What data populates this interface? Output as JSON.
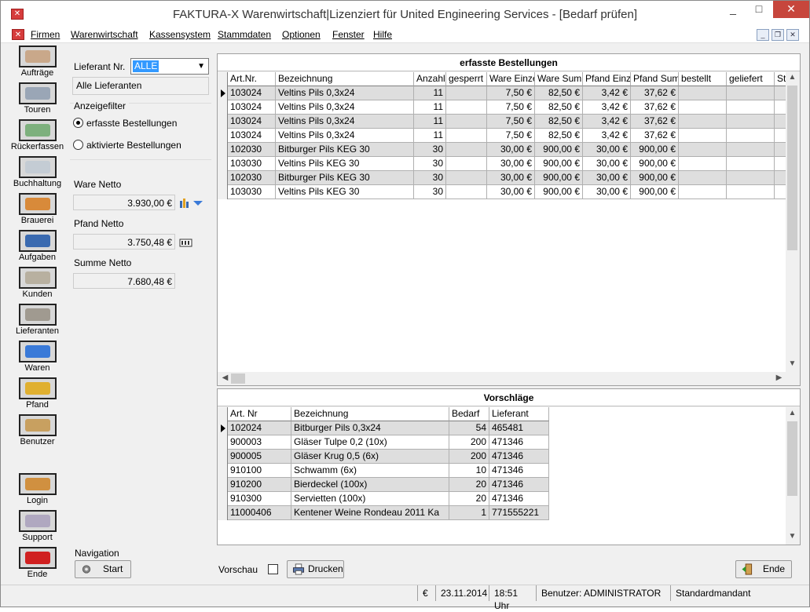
{
  "window": {
    "title": "FAKTURA-X Warenwirtschaft|Lizenziert für United Engineering Services - [Bedarf prüfen]"
  },
  "menu": [
    "Firmen",
    "Warenwirtschaft",
    "Kassensystem",
    "Stammdaten",
    "Optionen",
    "Fenster",
    "Hilfe"
  ],
  "sidebar": [
    {
      "label": "Aufträge",
      "icon": "orders-icon"
    },
    {
      "label": "Touren",
      "icon": "truck-icon"
    },
    {
      "label": "Rückerfassen",
      "icon": "return-icon"
    },
    {
      "label": "Buchhaltung",
      "icon": "accounting-icon"
    },
    {
      "label": "Brauerei",
      "icon": "brewery-icon"
    },
    {
      "label": "Aufgaben",
      "icon": "tasks-icon"
    },
    {
      "label": "Kunden",
      "icon": "customers-icon"
    },
    {
      "label": "Lieferanten",
      "icon": "suppliers-icon"
    },
    {
      "label": "Waren",
      "icon": "goods-icon"
    },
    {
      "label": "Pfand",
      "icon": "deposit-icon"
    },
    {
      "label": "Benutzer",
      "icon": "user-icon"
    },
    {
      "label": "Login",
      "icon": "key-icon"
    },
    {
      "label": "Support",
      "icon": "handshake-icon"
    },
    {
      "label": "Ende",
      "icon": "power-icon"
    }
  ],
  "filter": {
    "supplier_label": "Lieferant Nr.",
    "supplier_value": "ALLE",
    "supplier_name": "Alle Lieferanten",
    "display_filter_label": "Anzeigefilter",
    "radio_captured": "erfasste Bestellungen",
    "radio_activated": "aktivierte Bestellungen",
    "ware_netto_label": "Ware Netto",
    "ware_netto": "3.930,00 €",
    "pfand_netto_label": "Pfand Netto",
    "pfand_netto": "3.750,48 €",
    "summe_netto_label": "Summe Netto",
    "summe_netto": "7.680,48 €"
  },
  "orders": {
    "title": "erfasste Bestellungen",
    "columns": [
      "Art.Nr.",
      "Bezeichnung",
      "Anzahl",
      "gesperrt",
      "Ware Einzel",
      "Ware Summe",
      "Pfand Einzel",
      "Pfand Summe",
      "bestellt",
      "geliefert",
      "St"
    ],
    "rows": [
      [
        "103024",
        "Veltins Pils 0,3x24",
        "11",
        "",
        "7,50 €",
        "82,50 €",
        "3,42 €",
        "37,62 €",
        "",
        "",
        ""
      ],
      [
        "103024",
        "Veltins Pils 0,3x24",
        "11",
        "",
        "7,50 €",
        "82,50 €",
        "3,42 €",
        "37,62 €",
        "",
        "",
        ""
      ],
      [
        "103024",
        "Veltins Pils 0,3x24",
        "11",
        "",
        "7,50 €",
        "82,50 €",
        "3,42 €",
        "37,62 €",
        "",
        "",
        ""
      ],
      [
        "103024",
        "Veltins Pils 0,3x24",
        "11",
        "",
        "7,50 €",
        "82,50 €",
        "3,42 €",
        "37,62 €",
        "",
        "",
        ""
      ],
      [
        "102030",
        "Bitburger Pils KEG 30",
        "30",
        "",
        "30,00 €",
        "900,00 €",
        "30,00 €",
        "900,00 €",
        "",
        "",
        ""
      ],
      [
        "103030",
        "Veltins Pils KEG 30",
        "30",
        "",
        "30,00 €",
        "900,00 €",
        "30,00 €",
        "900,00 €",
        "",
        "",
        ""
      ],
      [
        "102030",
        "Bitburger Pils KEG 30",
        "30",
        "",
        "30,00 €",
        "900,00 €",
        "30,00 €",
        "900,00 €",
        "",
        "",
        ""
      ],
      [
        "103030",
        "Veltins Pils KEG 30",
        "30",
        "",
        "30,00 €",
        "900,00 €",
        "30,00 €",
        "900,00 €",
        "",
        "",
        ""
      ]
    ]
  },
  "suggestions": {
    "title": "Vorschläge",
    "columns": [
      "Art. Nr",
      "Bezeichnung",
      "Bedarf",
      "Lieferant"
    ],
    "rows": [
      [
        "102024",
        "Bitburger Pils 0,3x24",
        "54",
        "465481"
      ],
      [
        "900003",
        "Gläser Tulpe 0,2 (10x)",
        "200",
        "471346"
      ],
      [
        "900005",
        "Gläser Krug 0,5 (6x)",
        "200",
        "471346"
      ],
      [
        "910100",
        "Schwamm (6x)",
        "10",
        "471346"
      ],
      [
        "910200",
        "Bierdeckel (100x)",
        "20",
        "471346"
      ],
      [
        "910300",
        "Servietten (100x)",
        "20",
        "471346"
      ],
      [
        "11000406",
        "Kentener Weine Rondeau 2011 Ka",
        "1",
        "771555221"
      ]
    ]
  },
  "bottom": {
    "navigation_label": "Navigation",
    "start_button": "Start",
    "preview_label": "Vorschau",
    "print_button": "Drucken",
    "end_button": "Ende"
  },
  "status": {
    "currency": "€",
    "date": "23.11.2014",
    "time": "18:51 Uhr",
    "user": "Benutzer: ADMINISTRATOR",
    "tenant": "Standardmandant"
  }
}
